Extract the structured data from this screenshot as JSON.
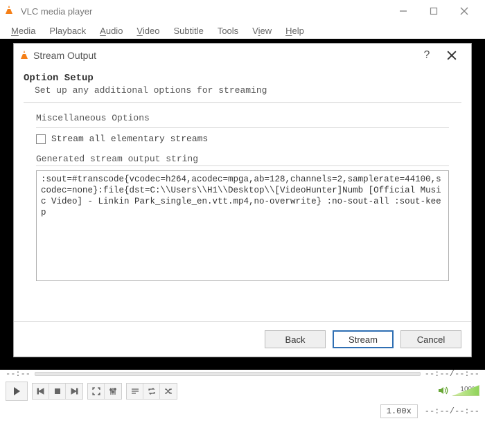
{
  "window": {
    "title": "VLC media player"
  },
  "menubar": {
    "items": [
      {
        "label": "Media",
        "underline": 0
      },
      {
        "label": "Playback",
        "underline": -1
      },
      {
        "label": "Audio",
        "underline": 0
      },
      {
        "label": "Video",
        "underline": 0
      },
      {
        "label": "Subtitle",
        "underline": -1
      },
      {
        "label": "Tools",
        "underline": -1
      },
      {
        "label": "View",
        "underline": 1
      },
      {
        "label": "Help",
        "underline": 0
      }
    ]
  },
  "dialog": {
    "title": "Stream Output",
    "heading": "Option Setup",
    "subheading": "Set up any additional options for streaming",
    "misc_label": "Miscellaneous Options",
    "checkbox_label": "Stream all elementary streams",
    "checkbox_checked": false,
    "generated_label": "Generated stream output string",
    "generated_string": ":sout=#transcode{vcodec=h264,acodec=mpga,ab=128,channels=2,samplerate=44100,scodec=none}:file{dst=C:\\\\Users\\\\H1\\\\Desktop\\\\[VideoHunter]Numb [Official Music Video] - Linkin Park_single_en.vtt.mp4,no-overwrite} :no-sout-all :sout-keep",
    "buttons": {
      "back": "Back",
      "stream": "Stream",
      "cancel": "Cancel"
    },
    "help_char": "?"
  },
  "playback": {
    "time_left": "--:--",
    "time_right": "--:--/--:--",
    "speed": "1.00x",
    "volume_pct": "100%"
  }
}
